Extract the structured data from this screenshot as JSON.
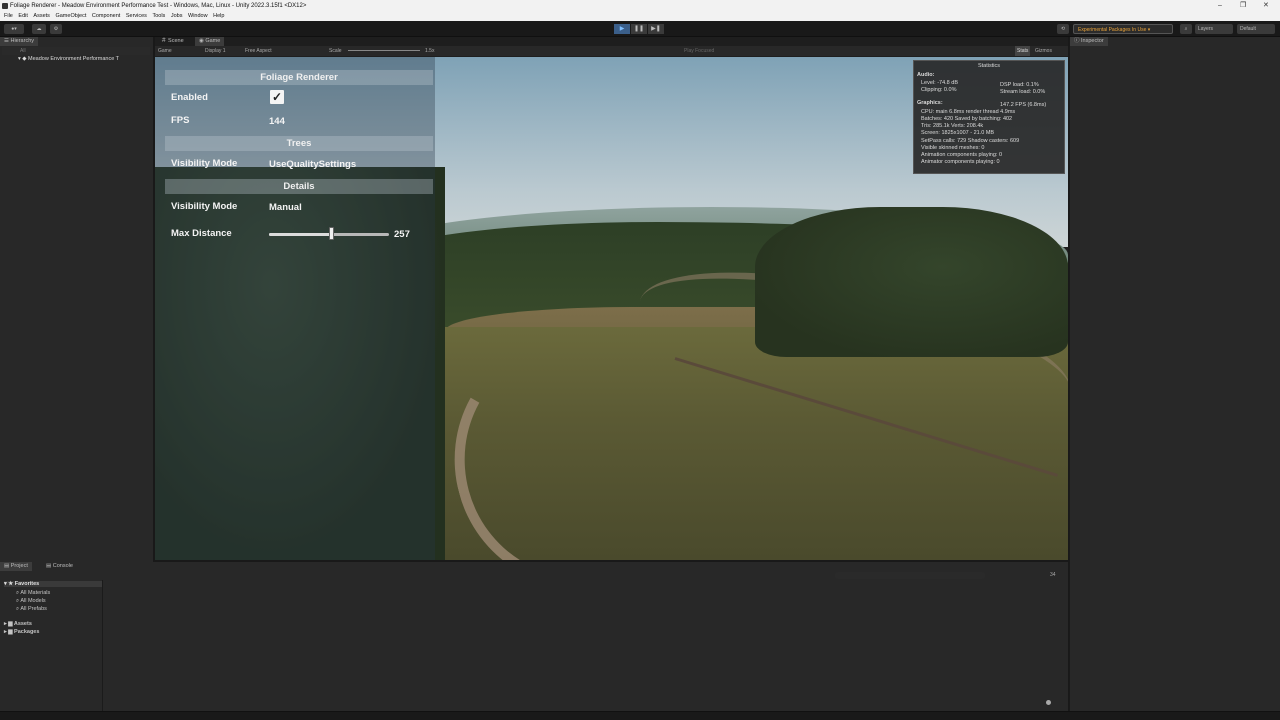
{
  "window": {
    "title": "Foliage Renderer - Meadow Environment Performance Test - Windows, Mac, Linux - Unity 2022.3.15f1 <DX12>",
    "minimize": "–",
    "maximize": "❐",
    "close": "✕"
  },
  "menu": [
    "File",
    "Edit",
    "Assets",
    "GameObject",
    "Component",
    "Services",
    "Tools",
    "Jobs",
    "Window",
    "Help"
  ],
  "toolbar": {
    "play_icon": "▶",
    "pause_icon": "❚❚",
    "step_icon": "▶❚",
    "packages_label": "Experimental Packages In Use ▾",
    "layers_label": "Layers",
    "layout_label": "Default"
  },
  "hierarchy": {
    "tab": "Hierarchy",
    "search_placeholder": "All",
    "scene_item": "Meadow Environment Performance T"
  },
  "game_tabs": {
    "scene": "Scene",
    "game": "Game"
  },
  "gamebar": {
    "view": "Game",
    "display": "Display 1",
    "aspect": "Free Aspect",
    "scale_label": "Scale",
    "scale_value": "1.5x",
    "play_mode": "Play Focused",
    "stats": "Stats",
    "gizmos": "Gizmos"
  },
  "foliage": {
    "title": "Foliage Renderer",
    "enabled_label": "Enabled",
    "enabled_check": "✓",
    "fps_label": "FPS",
    "fps_value": "144",
    "trees_header": "Trees",
    "trees_visibility_label": "Visibility Mode",
    "trees_visibility_value": "UseQualitySettings",
    "details_header": "Details",
    "details_visibility_label": "Visibility Mode",
    "details_visibility_value": "Manual",
    "max_distance_label": "Max Distance",
    "max_distance_value": "257",
    "max_distance_fraction": 0.52
  },
  "stats": {
    "title": "Statistics",
    "audio": "Audio:",
    "level": "Level: -74.8 dB",
    "dsp": "DSP load: 0.1%",
    "clipping": "Clipping: 0.0%",
    "stream": "Stream load: 0.0%",
    "graphics": "Graphics:",
    "fps": "147.2 FPS (6.8ms)",
    "cpu": "CPU: main 6.8ms  render thread 4.9ms",
    "batches": "Batches: 420   Saved by batching: 402",
    "tris": "Tris: 285.1k     Verts: 208.4k",
    "screen": "Screen: 1825x1007 - 21.0 MB",
    "setpass": "SetPass calls: 729      Shadow casters: 609",
    "skinned": "Visible skinned meshes: 0",
    "animation": "Animation components playing: 0",
    "animator": "Animator components playing: 0"
  },
  "project": {
    "tab_project": "Project",
    "tab_console": "Console",
    "favorites": "Favorites",
    "all_materials": "All Materials",
    "all_models": "All Models",
    "all_prefabs": "All Prefabs",
    "assets": "Assets",
    "packages": "Packages",
    "count": "34"
  },
  "inspector": {
    "tab": "Inspector"
  }
}
